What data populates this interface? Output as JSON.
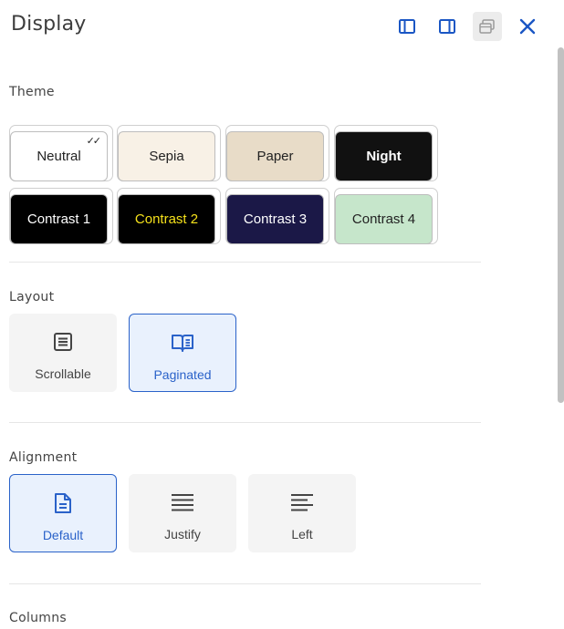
{
  "header": {
    "title": "Display",
    "buttons": [
      {
        "icon": "dock-left-icon"
      },
      {
        "icon": "dock-right-icon"
      },
      {
        "icon": "floating-window-icon"
      },
      {
        "icon": "close-icon"
      }
    ],
    "accent": "#1a56c4"
  },
  "theme": {
    "label": "Theme",
    "swatches": [
      {
        "label": "Neutral",
        "bg": "#ffffff",
        "fg": "#222222",
        "selected": true,
        "check": "✓✓"
      },
      {
        "label": "Sepia",
        "bg": "#f8f1e6",
        "fg": "#222222"
      },
      {
        "label": "Paper",
        "bg": "#e8dcc8",
        "fg": "#222222"
      },
      {
        "label": "Night",
        "bg": "#111111",
        "fg": "#ffffff"
      },
      {
        "label": "Contrast 1",
        "bg": "#000000",
        "fg": "#ffffff"
      },
      {
        "label": "Contrast 2",
        "bg": "#000000",
        "fg": "#f5e11b"
      },
      {
        "label": "Contrast 3",
        "bg": "#1b1847",
        "fg": "#ffffff"
      },
      {
        "label": "Contrast 4",
        "bg": "#c6e6cb",
        "fg": "#222222"
      }
    ]
  },
  "layout": {
    "label": "Layout",
    "options": [
      {
        "label": "Scrollable",
        "icon": "scrollable-document-icon",
        "selected": false
      },
      {
        "label": "Paginated",
        "icon": "open-book-icon",
        "selected": true
      }
    ]
  },
  "alignment": {
    "label": "Alignment",
    "options": [
      {
        "label": "Default",
        "icon": "document-icon",
        "selected": true
      },
      {
        "label": "Justify",
        "icon": "align-justify-icon",
        "selected": false
      },
      {
        "label": "Left",
        "icon": "align-left-icon",
        "selected": false
      }
    ]
  },
  "columns": {
    "label": "Columns"
  }
}
